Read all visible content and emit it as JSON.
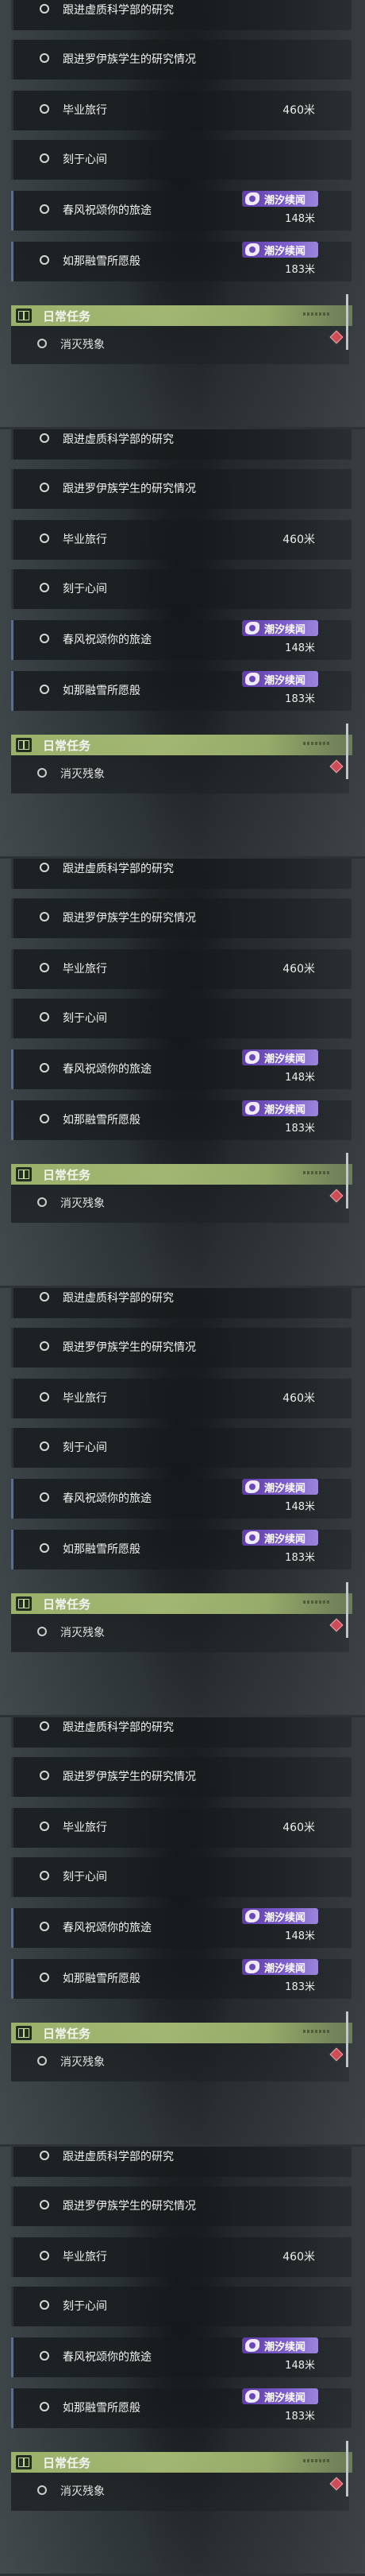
{
  "panels": [
    {
      "quests": [
        {
          "label": "跟进虚质科学部的研究"
        },
        {
          "label": "跟进罗伊族学生的研究情况"
        },
        {
          "label": "毕业旅行",
          "distance": "460米"
        },
        {
          "label": "刻于心间"
        },
        {
          "label": "春风祝颂你的旅途",
          "tag": "潮汐续闻",
          "distance": "148米"
        },
        {
          "label": "如那融雪所愿般",
          "tag": "潮汐续闻",
          "distance": "183米"
        }
      ],
      "daily_section": {
        "title": "日常任务",
        "quests": [
          {
            "label": "消灭残象"
          }
        ]
      }
    },
    {
      "quests": [
        {
          "label": "跟进虚质科学部的研究"
        },
        {
          "label": "跟进罗伊族学生的研究情况"
        },
        {
          "label": "毕业旅行",
          "distance": "460米"
        },
        {
          "label": "刻于心间"
        },
        {
          "label": "春风祝颂你的旅途",
          "tag": "潮汐续闻",
          "distance": "148米"
        },
        {
          "label": "如那融雪所愿般",
          "tag": "潮汐续闻",
          "distance": "183米"
        }
      ],
      "daily_section": {
        "title": "日常任务",
        "quests": [
          {
            "label": "消灭残象"
          }
        ]
      }
    },
    {
      "quests": [
        {
          "label": "跟进虚质科学部的研究"
        },
        {
          "label": "跟进罗伊族学生的研究情况"
        },
        {
          "label": "毕业旅行",
          "distance": "460米"
        },
        {
          "label": "刻于心间"
        },
        {
          "label": "春风祝颂你的旅途",
          "tag": "潮汐续闻",
          "distance": "148米"
        },
        {
          "label": "如那融雪所愿般",
          "tag": "潮汐续闻",
          "distance": "183米"
        }
      ],
      "daily_section": {
        "title": "日常任务",
        "quests": [
          {
            "label": "消灭残象"
          }
        ]
      }
    },
    {
      "quests": [
        {
          "label": "跟进虚质科学部的研究"
        },
        {
          "label": "跟进罗伊族学生的研究情况"
        },
        {
          "label": "毕业旅行",
          "distance": "460米"
        },
        {
          "label": "刻于心间"
        },
        {
          "label": "春风祝颂你的旅途",
          "tag": "潮汐续闻",
          "distance": "148米"
        },
        {
          "label": "如那融雪所愿般",
          "tag": "潮汐续闻",
          "distance": "183米"
        }
      ],
      "daily_section": {
        "title": "日常任务",
        "quests": [
          {
            "label": "消灭残象"
          }
        ]
      }
    },
    {
      "quests": [
        {
          "label": "跟进虚质科学部的研究"
        },
        {
          "label": "跟进罗伊族学生的研究情况"
        },
        {
          "label": "毕业旅行",
          "distance": "460米"
        },
        {
          "label": "刻于心间"
        },
        {
          "label": "春风祝颂你的旅途",
          "tag": "潮汐续闻",
          "distance": "148米"
        },
        {
          "label": "如那融雪所愿般",
          "tag": "潮汐续闻",
          "distance": "183米"
        }
      ],
      "daily_section": {
        "title": "日常任务",
        "quests": [
          {
            "label": "消灭残象"
          }
        ]
      }
    },
    {
      "quests": [
        {
          "label": "跟进虚质科学部的研究"
        },
        {
          "label": "跟进罗伊族学生的研究情况"
        },
        {
          "label": "毕业旅行",
          "distance": "460米"
        },
        {
          "label": "刻于心间"
        },
        {
          "label": "春风祝颂你的旅途",
          "tag": "潮汐续闻",
          "distance": "148米"
        },
        {
          "label": "如那融雪所愿般",
          "tag": "潮汐续闻",
          "distance": "183米"
        }
      ],
      "daily_section": {
        "title": "日常任务",
        "quests": [
          {
            "label": "消灭残象"
          }
        ]
      }
    }
  ],
  "icons": {
    "quest_marker": "radio-circle-icon",
    "tag_marker": "tide-badge-icon",
    "section_marker": "book-icon",
    "alert_marker": "red-diamond-icon"
  },
  "colors": {
    "tag_purple": "#7f5fd0",
    "section_green": "#a7bc74",
    "alert_red": "#d84a57"
  }
}
